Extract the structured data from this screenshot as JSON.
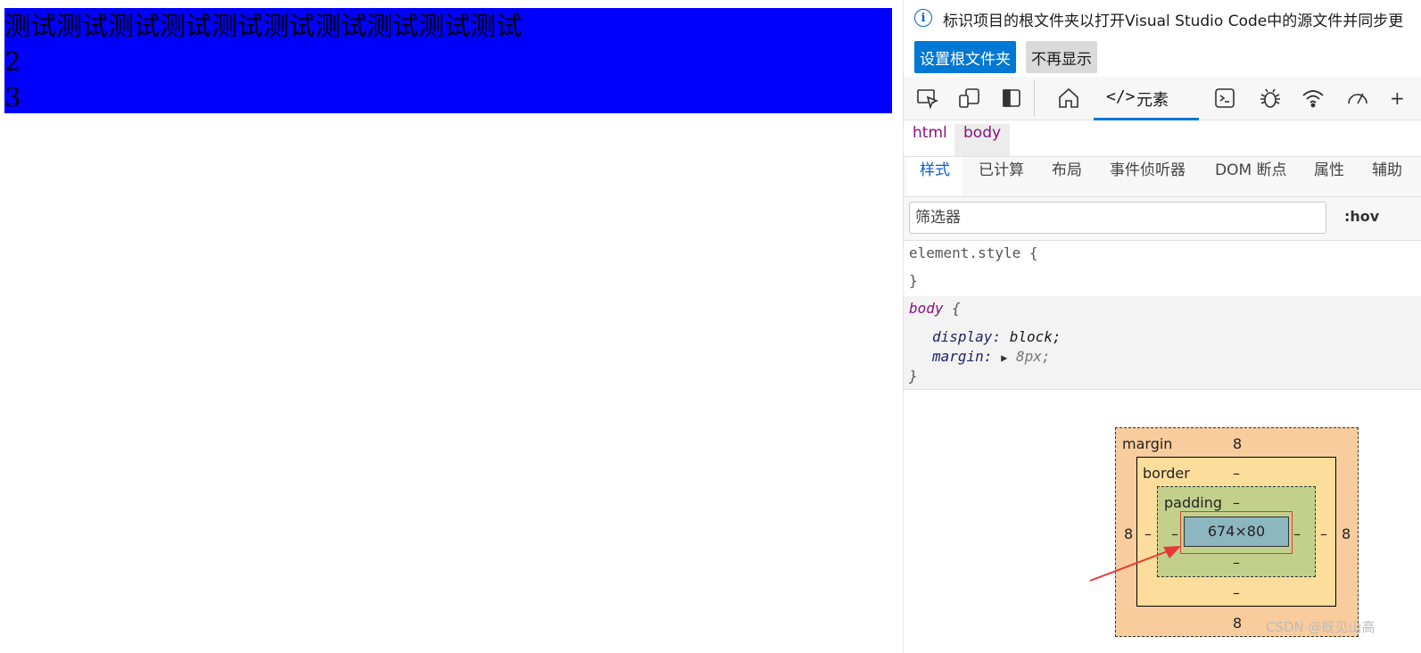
{
  "preview": {
    "lines": [
      "测试测试测试测试测试测试测试测试测试测试",
      "2",
      "3"
    ],
    "bg_color": "#0000ff"
  },
  "devtools": {
    "info_bar": {
      "icon": "info-icon",
      "text": "标识项目的根文件夹以打开Visual Studio Code中的源文件并同步更",
      "primary_button": "设置根文件夹",
      "secondary_button": "不再显示"
    },
    "toolbar": {
      "icons": [
        "inspect-icon",
        "device-emulation-icon",
        "dock-side-icon",
        "home-icon",
        "console-icon",
        "debugger-icon",
        "network-icon",
        "performance-icon"
      ],
      "active_tab": {
        "glyph": "</>",
        "label": "元素"
      },
      "accent": "#0078d4"
    },
    "breadcrumb": [
      "html",
      "body"
    ],
    "subtabs": [
      "样式",
      "已计算",
      "布局",
      "事件侦听器",
      "DOM 断点",
      "属性",
      "辅助"
    ],
    "filter": {
      "placeholder": "筛选器",
      "hov_label": ":hov"
    },
    "styles": {
      "element_style": {
        "selector": "element.style",
        "open": "{",
        "close": "}"
      },
      "body_rule": {
        "selector": "body",
        "open": "{",
        "close": "}",
        "declarations": [
          {
            "prop": "display",
            "value": "block;"
          },
          {
            "prop": "margin",
            "value": "8px;"
          }
        ]
      }
    },
    "box_model": {
      "margin_label": "margin",
      "margin_top": "8",
      "margin_bottom": "8",
      "margin_left": "8",
      "margin_right": "8",
      "border_label": "border",
      "border_top": "–",
      "border_bottom": "–",
      "border_left": "–",
      "border_right": "–",
      "padding_label": "padding",
      "padding_top": "–",
      "padding_bottom": "–",
      "padding_left": "–",
      "padding_right": "–",
      "content": "674×80",
      "colors": {
        "margin": "#f9cc9d",
        "border": "#fddd9b",
        "padding": "#c3d08b",
        "content": "#8cb6c0",
        "annotation": "#e53935"
      }
    },
    "watermark": "CSDN @既见山高"
  }
}
